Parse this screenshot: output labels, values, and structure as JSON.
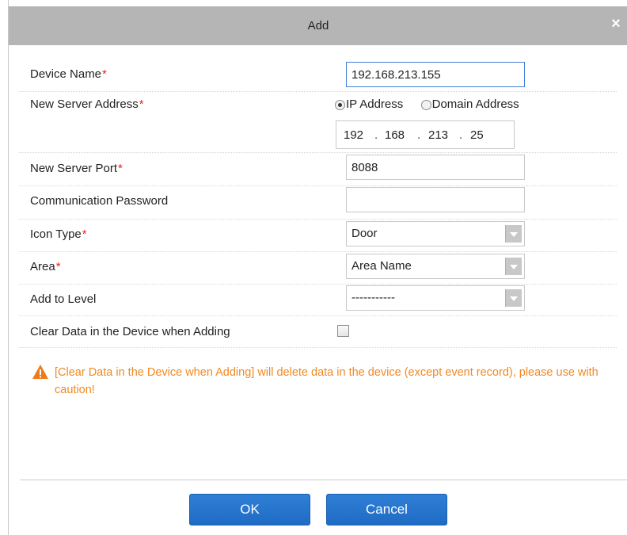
{
  "dialog": {
    "title": "Add",
    "close_glyph": "×"
  },
  "form": {
    "required_mark": "*",
    "device_name": {
      "label": "Device Name",
      "value": "192.168.213.155",
      "required": true
    },
    "server_address": {
      "label": "New Server Address",
      "required": true,
      "options": [
        "IP Address",
        "Domain Address"
      ],
      "selected": "IP Address",
      "ip": [
        "192",
        "168",
        "213",
        "25"
      ],
      "separator": "."
    },
    "server_port": {
      "label": "New Server Port",
      "value": "8088",
      "required": true
    },
    "comm_password": {
      "label": "Communication Password",
      "value": "",
      "required": false
    },
    "icon_type": {
      "label": "Icon Type",
      "value": "Door",
      "required": true
    },
    "area": {
      "label": "Area",
      "value": "Area Name",
      "required": true
    },
    "add_to_level": {
      "label": "Add to Level",
      "value": "-----------",
      "required": false
    },
    "clear_data": {
      "label": "Clear Data in the Device when Adding",
      "checked": false
    }
  },
  "warning": {
    "icon": "warning-triangle-icon",
    "text": "[Clear Data in the Device when Adding] will delete data in the device (except event record), please use with caution!"
  },
  "buttons": {
    "ok": "OK",
    "cancel": "Cancel"
  },
  "colors": {
    "titlebar": "#b5b5b5",
    "required": "#e0261f",
    "warning": "#f08a24",
    "button": "#2275cf",
    "focus_border": "#3f7fd8"
  }
}
